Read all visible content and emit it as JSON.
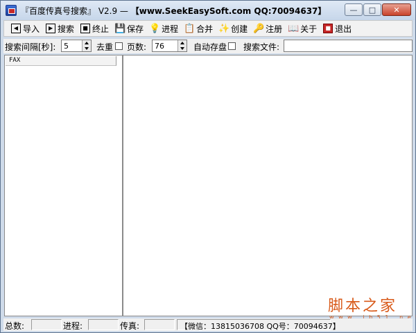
{
  "window": {
    "title_prefix": "『百度传真号搜索』 V2.9 — ",
    "title_url": "【www.SeekEasySoft.com QQ:70094637】",
    "minimize_icon": "minimize-icon",
    "maximize_icon": "maximize-icon",
    "close_icon": "close-icon"
  },
  "toolbar": {
    "import": "导入",
    "search": "搜索",
    "stop": "终止",
    "save": "保存",
    "progress": "进程",
    "merge": "合并",
    "create": "创建",
    "register": "注册",
    "about": "关于",
    "exit": "退出"
  },
  "options": {
    "interval_label": "搜索间隔[秒]:",
    "interval_value": "5",
    "dedup_label": "去重",
    "pages_label": "页数:",
    "pages_value": "76",
    "autosave_label": "自动存盘",
    "search_file_label": "搜索文件:",
    "search_file_value": ""
  },
  "list": {
    "column_header": "FAX"
  },
  "watermark": {
    "text": "脚本之家",
    "sub": "w w w . j b 5 1 . n e t"
  },
  "status": {
    "total_label": "总数:",
    "progress_label": "进程:",
    "fax_label": "传真:",
    "contact": "【微信：13815036708 QQ号：70094637】"
  },
  "colors": {
    "title_bg": "#cfdbea",
    "close_button": "#c9442b",
    "watermark": "#d85a1a"
  }
}
